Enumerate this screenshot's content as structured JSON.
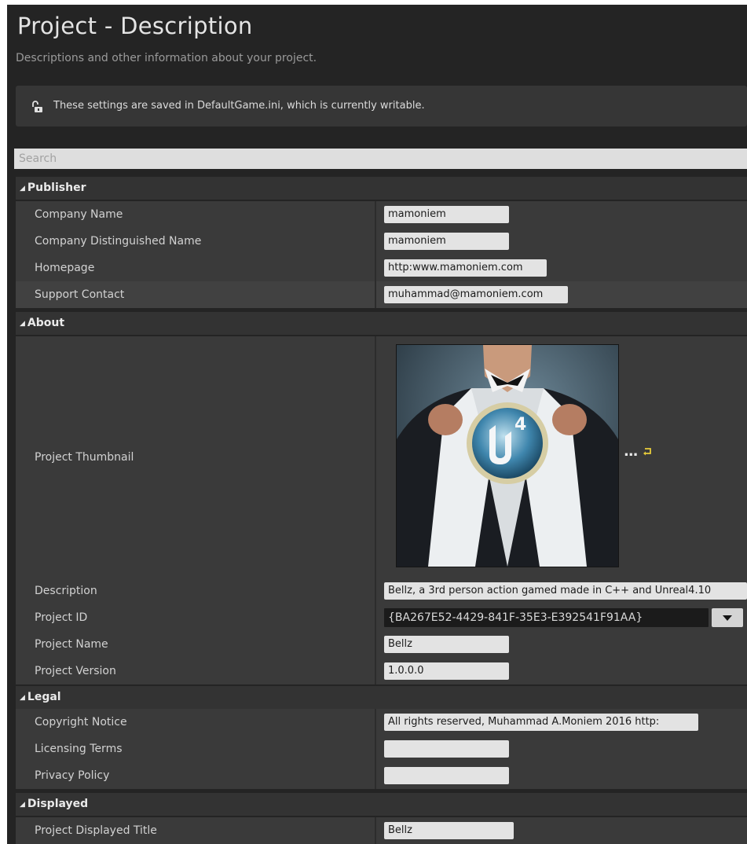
{
  "header": {
    "title": "Project - Description",
    "subtitle": "Descriptions and other information about your project."
  },
  "notice": {
    "icon": "unlocked-padlock-icon",
    "text": "These settings are saved in DefaultGame.ini, which is currently writable."
  },
  "search": {
    "placeholder": "Search",
    "value": ""
  },
  "publisher": {
    "label": "Publisher",
    "company_name": {
      "label": "Company Name",
      "value": "mamoniem"
    },
    "company_distinguished_name": {
      "label": "Company Distinguished Name",
      "value": "mamoniem"
    },
    "homepage": {
      "label": "Homepage",
      "value": "http:www.mamoniem.com"
    },
    "support_contact": {
      "label": "Support Contact",
      "value": "muhammad@mamoniem.com"
    }
  },
  "about": {
    "label": "About",
    "project_thumbnail": {
      "label": "Project Thumbnail",
      "image": "man-in-suit-opening-shirt-with-unreal-engine-4-logo",
      "browse": "...",
      "reset_icon": "reset-to-default-arrow-icon"
    },
    "description": {
      "label": "Description",
      "value": "Bellz, a 3rd person action gamed made in C++ and Unreal4.10"
    },
    "project_id": {
      "label": "Project ID",
      "value": "{BA267E52-4429-841F-35E3-E392541F91AA}"
    },
    "project_name": {
      "label": "Project Name",
      "value": "Bellz"
    },
    "project_version": {
      "label": "Project Version",
      "value": "1.0.0.0"
    }
  },
  "legal": {
    "label": "Legal",
    "copyright_notice": {
      "label": "Copyright Notice",
      "value": "All rights reserved, Muhammad A.Moniem 2016 http:"
    },
    "licensing_terms": {
      "label": "Licensing Terms",
      "value": ""
    },
    "privacy_policy": {
      "label": "Privacy Policy",
      "value": ""
    }
  },
  "displayed": {
    "label": "Displayed",
    "project_displayed_title": {
      "label": "Project Displayed Title",
      "value": "Bellz"
    }
  }
}
